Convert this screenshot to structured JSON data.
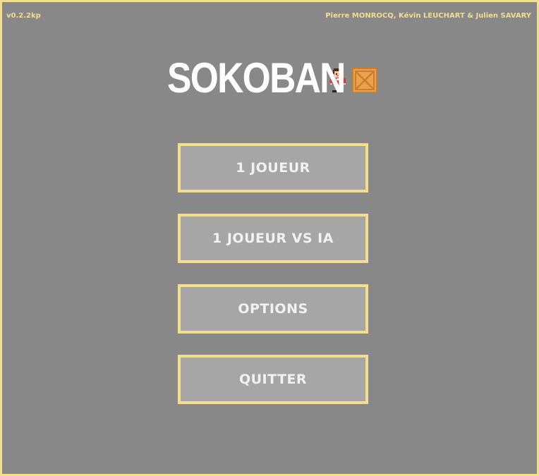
{
  "header": {
    "version": "v0.2.2kp",
    "credits": "Pierre MONROCQ, Kévin LEUCHART & Julien SAVARY"
  },
  "title": {
    "text": "SOKOBAN",
    "icons": [
      "player-sprite-icon",
      "crate-icon"
    ]
  },
  "menu": {
    "single_player": "1 JOUEUR",
    "player_vs_ai": "1 JOUEUR VS IA",
    "options": "OPTIONS",
    "quit": "QUITTER"
  },
  "colors": {
    "background": "#888888",
    "accent": "#f2de8c",
    "button_fill": "#a6a6a6",
    "button_text": "#f2f2f2",
    "title_text": "#ffffff",
    "crate": "#e8a04a"
  }
}
